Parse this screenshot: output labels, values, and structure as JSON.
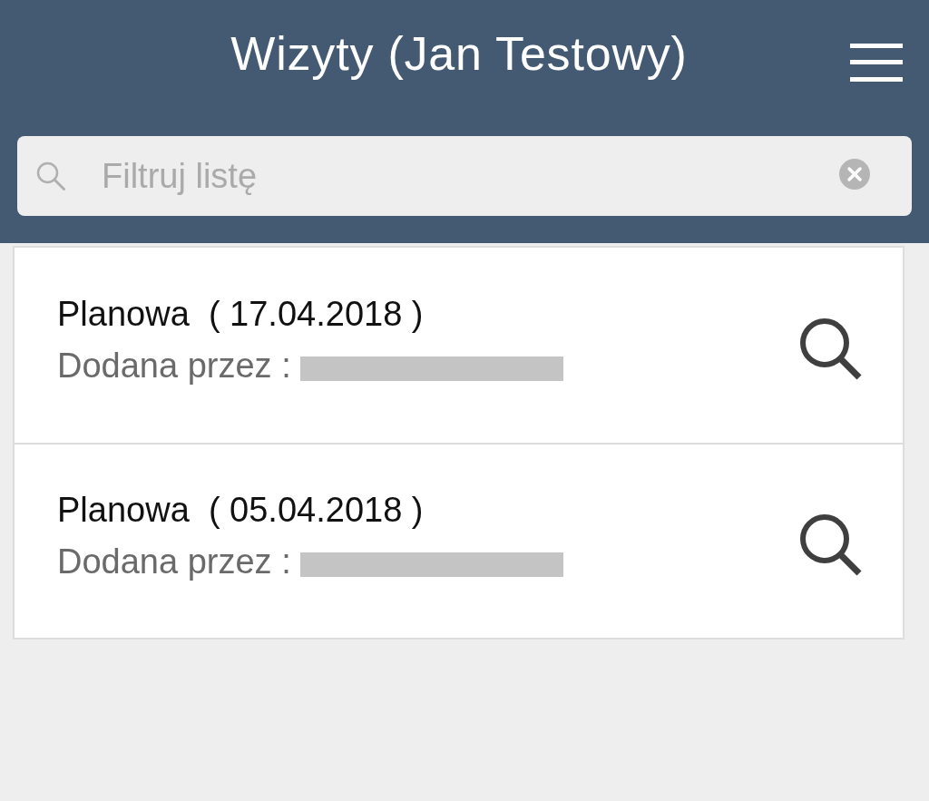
{
  "header": {
    "title": "Wizyty (Jan Testowy)"
  },
  "search": {
    "placeholder": "Filtruj listę"
  },
  "visits": [
    {
      "title": "Planowa  ( 17.04.2018 )",
      "added_by_label": "Dodana przez :",
      "name_redacted": true
    },
    {
      "title": "Planowa  ( 05.04.2018 )",
      "added_by_label": "Dodana przez :",
      "name_redacted": true
    }
  ]
}
